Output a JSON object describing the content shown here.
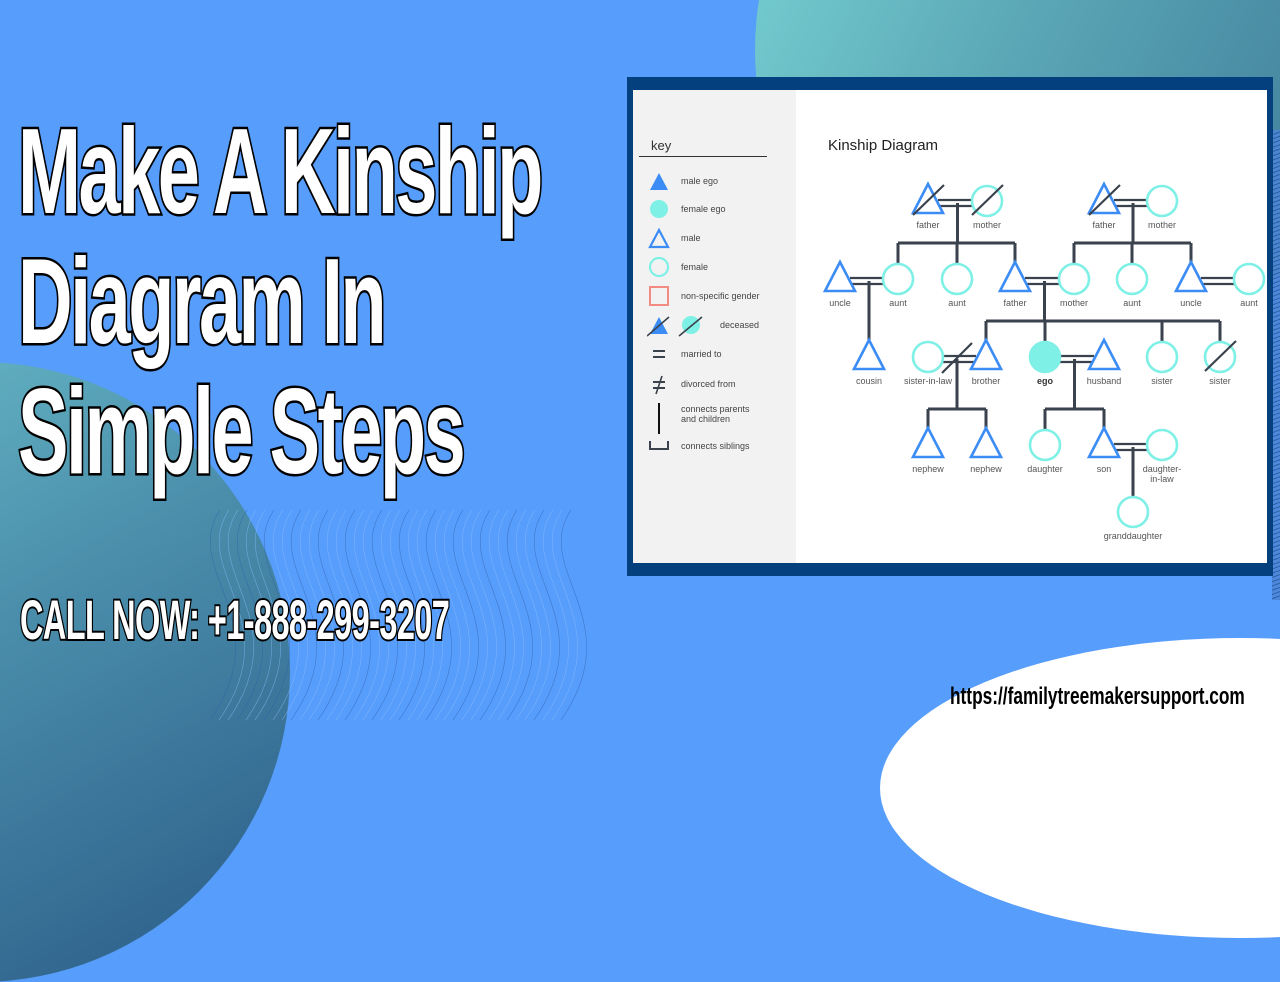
{
  "headline": {
    "lines": [
      "Make A Kinship",
      "Diagram In",
      "Simple Steps"
    ]
  },
  "call_to_action": "CALL NOW: +1-888-299-3207",
  "website": "https://familytreemakersupport.com",
  "colors": {
    "background": "#579dfc",
    "frame": "#043f7e",
    "male": "#3b8cf5",
    "female": "#7ef0e6",
    "nonspecific": "#f28b82",
    "line": "#3a424d"
  },
  "diagram": {
    "title": "Kinship Diagram",
    "key": {
      "title": "key",
      "items": [
        {
          "symbol": "filled-triangle-icon",
          "label": "male ego"
        },
        {
          "symbol": "filled-circle-icon",
          "label": "female ego"
        },
        {
          "symbol": "outline-triangle-icon",
          "label": "male"
        },
        {
          "symbol": "outline-circle-icon",
          "label": "female"
        },
        {
          "symbol": "outline-square-icon",
          "label": "non-specific gender"
        },
        {
          "symbol": "deceased-icon",
          "label": "deceased"
        },
        {
          "symbol": "equals-icon",
          "label": "married to"
        },
        {
          "symbol": "not-equal-icon",
          "label": "divorced from"
        },
        {
          "symbol": "vertical-line-icon",
          "label": "connects parents and children"
        },
        {
          "symbol": "bracket-icon",
          "label": "connects siblings"
        }
      ]
    },
    "people": [
      {
        "id": "pf",
        "label": "father",
        "sex": "male",
        "deceased": true
      },
      {
        "id": "pm",
        "label": "mother",
        "sex": "female",
        "deceased": true
      },
      {
        "id": "mf",
        "label": "father",
        "sex": "male",
        "deceased": true
      },
      {
        "id": "mm",
        "label": "mother",
        "sex": "female",
        "deceased": false
      },
      {
        "id": "u1",
        "label": "uncle",
        "sex": "male",
        "deceased": false
      },
      {
        "id": "a1",
        "label": "aunt",
        "sex": "female",
        "deceased": false
      },
      {
        "id": "a2",
        "label": "aunt",
        "sex": "female",
        "deceased": false
      },
      {
        "id": "f",
        "label": "father",
        "sex": "male",
        "deceased": false
      },
      {
        "id": "m",
        "label": "mother",
        "sex": "female",
        "deceased": false
      },
      {
        "id": "a3",
        "label": "aunt",
        "sex": "female",
        "deceased": false
      },
      {
        "id": "u2",
        "label": "uncle",
        "sex": "male",
        "deceased": false
      },
      {
        "id": "a4",
        "label": "aunt",
        "sex": "female",
        "deceased": false
      },
      {
        "id": "c",
        "label": "cousin",
        "sex": "male",
        "deceased": false
      },
      {
        "id": "sil",
        "label": "sister-in-law",
        "sex": "female",
        "deceased": false
      },
      {
        "id": "b",
        "label": "brother",
        "sex": "male",
        "deceased": false
      },
      {
        "id": "ego",
        "label": "ego",
        "sex": "female",
        "ego": true,
        "deceased": false
      },
      {
        "id": "h",
        "label": "husband",
        "sex": "male",
        "deceased": false
      },
      {
        "id": "s1",
        "label": "sister",
        "sex": "female",
        "deceased": false
      },
      {
        "id": "s2",
        "label": "sister",
        "sex": "female",
        "deceased": true
      },
      {
        "id": "n1",
        "label": "nephew",
        "sex": "male",
        "deceased": false
      },
      {
        "id": "n2",
        "label": "nephew",
        "sex": "male",
        "deceased": false
      },
      {
        "id": "d",
        "label": "daughter",
        "sex": "female",
        "deceased": false
      },
      {
        "id": "son",
        "label": "son",
        "sex": "male",
        "deceased": false
      },
      {
        "id": "dil",
        "label": "daughter-in-law",
        "sex": "female",
        "deceased": false
      },
      {
        "id": "gd",
        "label": "granddaughter",
        "sex": "female",
        "deceased": false
      }
    ],
    "marriages": [
      {
        "a": "pf",
        "b": "pm",
        "type": "married"
      },
      {
        "a": "mf",
        "b": "mm",
        "type": "married"
      },
      {
        "a": "u1",
        "b": "a1",
        "type": "married"
      },
      {
        "a": "f",
        "b": "m",
        "type": "married"
      },
      {
        "a": "u2",
        "b": "a4",
        "type": "married"
      },
      {
        "a": "sil",
        "b": "b",
        "type": "divorced"
      },
      {
        "a": "ego",
        "b": "h",
        "type": "married"
      },
      {
        "a": "son",
        "b": "dil",
        "type": "married"
      }
    ],
    "descent": [
      {
        "parents": [
          "pf",
          "pm"
        ],
        "children": [
          "a1",
          "a2",
          "f"
        ]
      },
      {
        "parents": [
          "mf",
          "mm"
        ],
        "children": [
          "m",
          "a3",
          "u2"
        ]
      },
      {
        "parents": [
          "u1",
          "a1"
        ],
        "children": [
          "c"
        ]
      },
      {
        "parents": [
          "f",
          "m"
        ],
        "children": [
          "b",
          "ego",
          "s1",
          "s2"
        ]
      },
      {
        "parents": [
          "sil",
          "b"
        ],
        "children": [
          "n1",
          "n2"
        ]
      },
      {
        "parents": [
          "ego",
          "h"
        ],
        "children": [
          "d",
          "son"
        ]
      },
      {
        "parents": [
          "son",
          "dil"
        ],
        "children": [
          "gd"
        ]
      }
    ]
  }
}
